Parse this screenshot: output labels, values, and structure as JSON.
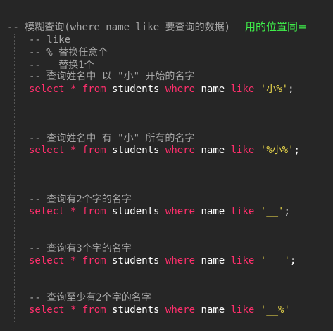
{
  "header": {
    "comment": "-- 模糊查询(where name like 要查询的数据)",
    "annotation": "用的位置同="
  },
  "notes": [
    "-- like",
    "-- % 替换任意个",
    "-- _ 替换1个"
  ],
  "blocks": [
    {
      "comment": "-- 查询姓名中 以 \"小\" 开始的名字",
      "sql": {
        "select": "select",
        "star": " * ",
        "from": "from",
        "table": " students ",
        "where": "where",
        "column": " name ",
        "like": "like",
        "pattern": " '小%'",
        "end": ";"
      }
    },
    {
      "comment": "-- 查询姓名中 有 \"小\" 所有的名字",
      "sql": {
        "select": "select",
        "star": " * ",
        "from": "from",
        "table": " students ",
        "where": "where",
        "column": " name ",
        "like": "like",
        "pattern": " '%小%'",
        "end": ";"
      }
    },
    {
      "comment": "-- 查询有2个字的名字",
      "sql": {
        "select": "select",
        "star": " * ",
        "from": "from",
        "table": " students ",
        "where": "where",
        "column": " name ",
        "like": "like",
        "pattern": " '__'",
        "end": ";"
      }
    },
    {
      "comment": "-- 查询有3个字的名字",
      "sql": {
        "select": "select",
        "star": " * ",
        "from": "from",
        "table": " students ",
        "where": "where",
        "column": " name ",
        "like": "like",
        "pattern": " '___'",
        "end": ";"
      }
    },
    {
      "comment": "-- 查询至少有2个字的名字",
      "sql": {
        "select": "select",
        "star": " * ",
        "from": "from",
        "table": " students ",
        "where": "where",
        "column": " name ",
        "like": "like",
        "pattern": " '__%'",
        "end": ""
      }
    }
  ],
  "colors": {
    "background": "#262626",
    "comment": "#a8a8a8",
    "keyword": "#ff2f6c",
    "identifier": "#ffffff",
    "string": "#e6d44a",
    "annotation": "#3ff04a"
  }
}
